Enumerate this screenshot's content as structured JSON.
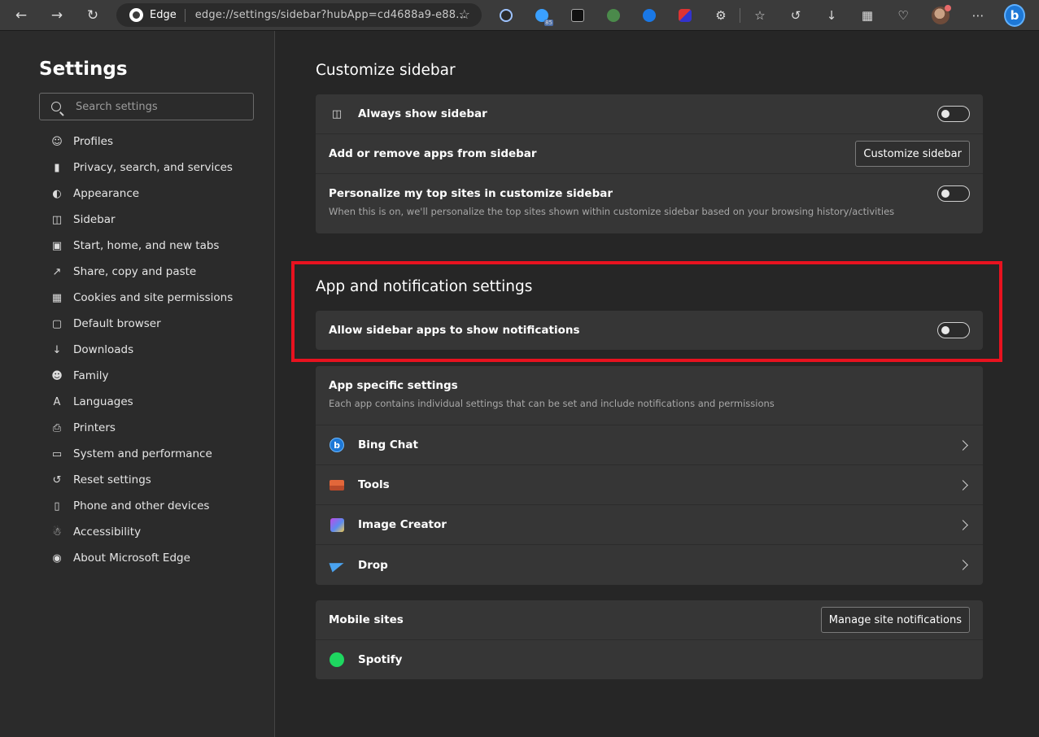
{
  "browser": {
    "site_name": "Edge",
    "url": "edge://settings/sidebar?hubApp=cd4688a9-e88...",
    "extension_badge": "85"
  },
  "nav": {
    "title": "Settings",
    "search_placeholder": "Search settings",
    "items": [
      {
        "label": "Profiles",
        "icon": "profile-icon"
      },
      {
        "label": "Privacy, search, and services",
        "icon": "lock-icon"
      },
      {
        "label": "Appearance",
        "icon": "palette-icon"
      },
      {
        "label": "Sidebar",
        "icon": "sidebar-icon"
      },
      {
        "label": "Start, home, and new tabs",
        "icon": "home-icon"
      },
      {
        "label": "Share, copy and paste",
        "icon": "share-icon"
      },
      {
        "label": "Cookies and site permissions",
        "icon": "cookies-icon"
      },
      {
        "label": "Default browser",
        "icon": "browser-icon"
      },
      {
        "label": "Downloads",
        "icon": "download-icon"
      },
      {
        "label": "Family",
        "icon": "family-icon"
      },
      {
        "label": "Languages",
        "icon": "languages-icon"
      },
      {
        "label": "Printers",
        "icon": "printer-icon"
      },
      {
        "label": "System and performance",
        "icon": "laptop-icon"
      },
      {
        "label": "Reset settings",
        "icon": "reset-icon"
      },
      {
        "label": "Phone and other devices",
        "icon": "phone-icon"
      },
      {
        "label": "Accessibility",
        "icon": "accessibility-icon"
      },
      {
        "label": "About Microsoft Edge",
        "icon": "edge-logo-icon"
      }
    ]
  },
  "customize": {
    "title": "Customize sidebar",
    "always_show": "Always show sidebar",
    "add_remove": "Add or remove apps from sidebar",
    "customize_button": "Customize sidebar",
    "personalize": "Personalize my top sites in customize sidebar",
    "personalize_desc": "When this is on, we'll personalize the top sites shown within customize sidebar based on your browsing history/activities"
  },
  "notifications": {
    "title": "App and notification settings",
    "allow": "Allow sidebar apps to show notifications"
  },
  "app_specific": {
    "title": "App specific settings",
    "desc": "Each app contains individual settings that can be set and include notifications and permissions",
    "apps": [
      "Bing Chat",
      "Tools",
      "Image Creator",
      "Drop"
    ]
  },
  "mobile": {
    "title": "Mobile sites",
    "manage_button": "Manage site notifications",
    "sites": [
      "Spotify"
    ]
  },
  "colors": {
    "highlight": "#e8121f",
    "background": "#262626",
    "card": "#363636"
  }
}
